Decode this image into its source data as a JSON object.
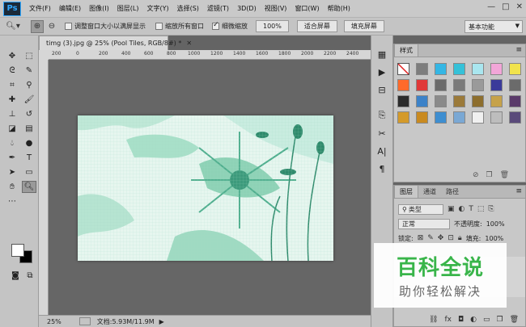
{
  "app": {
    "logo": "Ps"
  },
  "menu": [
    "文件(F)",
    "编辑(E)",
    "图像(I)",
    "图层(L)",
    "文字(Y)",
    "选择(S)",
    "滤镜(T)",
    "3D(D)",
    "视图(V)",
    "窗口(W)",
    "帮助(H)"
  ],
  "window_controls": {
    "minimize": "—",
    "maximize": "□",
    "close": "✕"
  },
  "options": {
    "resize_windows_label": "调整窗口大小以满屏显示",
    "zoom_all_windows_label": "缩放所有窗口",
    "scrubby_zoom_label": "细微缩放",
    "zoom_value": "100%",
    "fit_screen_label": "适合屏幕",
    "fill_screen_label": "填充屏幕",
    "workspace": "基本功能",
    "resize_windows_checked": false,
    "zoom_all_checked": false,
    "scrubby_zoom_checked": true
  },
  "document": {
    "tab_title": "timg (3).jpg @ 25% (Pool Tiles, RGB/8#) *",
    "zoom": "25%",
    "doc_size": "文档:5.93M/11.9M"
  },
  "ruler": {
    "ticks": [
      "200",
      "0",
      "200",
      "400",
      "600",
      "800",
      "1000",
      "1200",
      "1400",
      "1600",
      "1800",
      "2000",
      "2200",
      "2400"
    ]
  },
  "styles_panel": {
    "tab": "样式",
    "swatches": [
      "#ffffff",
      "#7d7d7d",
      "#34b6e4",
      "#35c1d8",
      "#a9e6ef",
      "#f2a6d8",
      "#f1e34c",
      "#ff6a2a",
      "#e03838",
      "#6a6a6a",
      "#7a7a7a",
      "#9a9a9a",
      "#3a3a9a",
      "#6b6b6b",
      "#2b2b2b",
      "#3c82c8",
      "#8a8a8a",
      "#9b7a3a",
      "#8d6e2e",
      "#c6a24a",
      "#5a3a6a",
      "#d49a2a",
      "#c98a20",
      "#3e8ed0",
      "#7aa8d4",
      "#f0f0f0",
      "#bdbdbd",
      "#5a4a7a"
    ]
  },
  "layers_panel": {
    "tabs": [
      "图层",
      "通道",
      "路径"
    ],
    "kind_label": "类型",
    "blend_mode": "正常",
    "opacity_label": "不透明度:",
    "opacity_value": "100%",
    "lock_label": "锁定:",
    "fill_label": "填充:",
    "fill_value": "100%"
  },
  "watermark": {
    "title": "百科全说",
    "subtitle": "助你轻松解决"
  }
}
